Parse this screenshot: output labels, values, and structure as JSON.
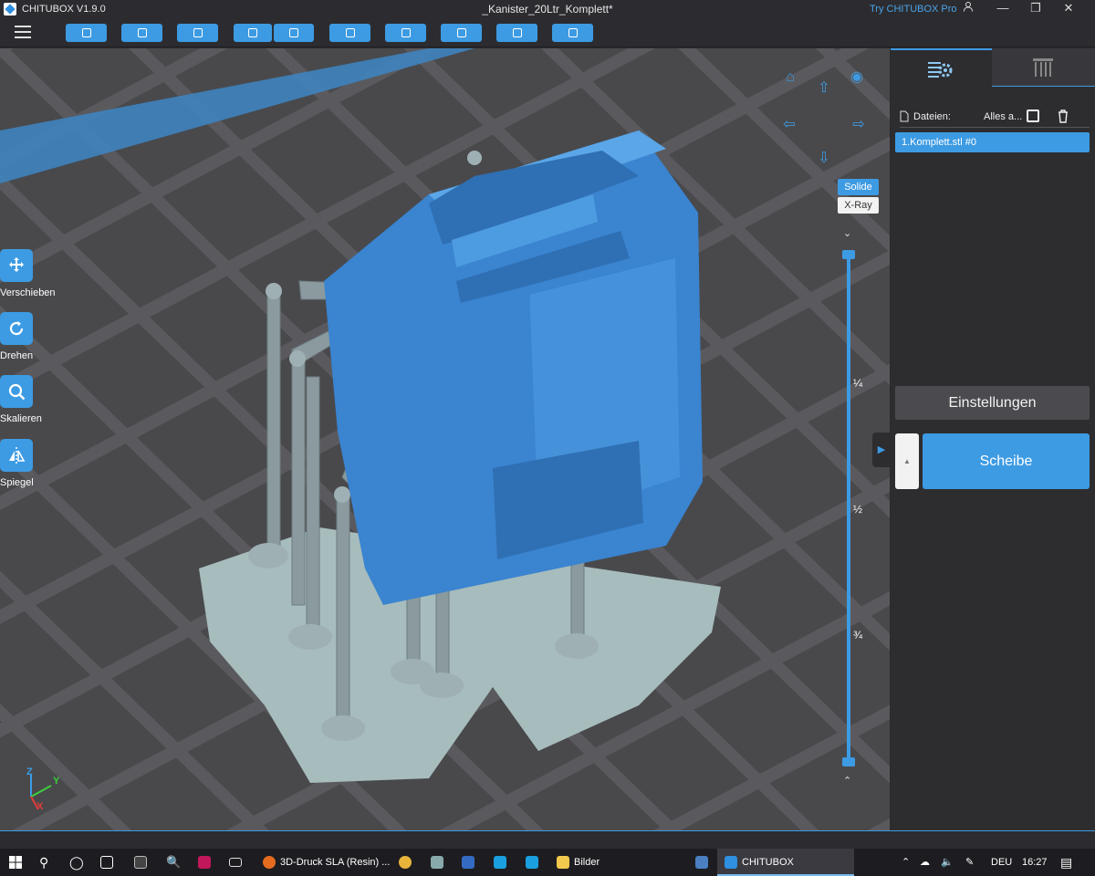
{
  "window": {
    "app_name": "CHITUBOX V1.9.0",
    "document_title": "_Kanister_20Ltr_Komplett*",
    "try_pro": "Try CHITUBOX Pro",
    "controls": [
      "user-icon",
      "minimize-icon",
      "restore-icon",
      "close-icon"
    ]
  },
  "toolbar": {
    "menu_icon": "hamburger-icon",
    "buttons": [
      "open-file-icon",
      "save-icon",
      "auto-layout-icon",
      "import-icon",
      "export-icon",
      "copy-icon",
      "supports-icon",
      "hollow-icon",
      "drill-icon",
      "lock-icon"
    ]
  },
  "left_tools": [
    {
      "label": "Verschieben",
      "icon": "move-icon"
    },
    {
      "label": "Drehen",
      "icon": "rotate-icon"
    },
    {
      "label": "Skalieren",
      "icon": "scale-icon"
    },
    {
      "label": "Spiegel",
      "icon": "mirror-icon"
    }
  ],
  "view": {
    "modes": [
      "Solide",
      "X-Ray"
    ],
    "active_mode": "Solide",
    "slider_marks": [
      "¼",
      "½",
      "¾"
    ],
    "slider_range": {
      "low": 0.0,
      "high": 1.0
    },
    "axes": {
      "z": "Z",
      "y": "Y",
      "x": "X"
    }
  },
  "panel": {
    "tabs": [
      "settings-list-icon",
      "supports-tab-icon"
    ],
    "files_label": "Dateien:",
    "select_all": "Alles a...",
    "files": [
      "1.Komplett.stl #0"
    ],
    "settings_button": "Einstellungen",
    "slice_button": "Scheibe"
  },
  "taskbar": {
    "apps": [
      {
        "label": "3D-Druck SLA (Resin) ...",
        "icon": "firefox-icon"
      },
      {
        "label": "Bilder",
        "icon": "folder-icon"
      },
      {
        "label": "CHITUBOX",
        "icon": "chitubox-icon"
      }
    ],
    "language": "DEU",
    "time": "16:27",
    "colors": {
      "accent": "#3d9be3",
      "model": "#3a84d0",
      "support": "#8a9a9e"
    }
  }
}
